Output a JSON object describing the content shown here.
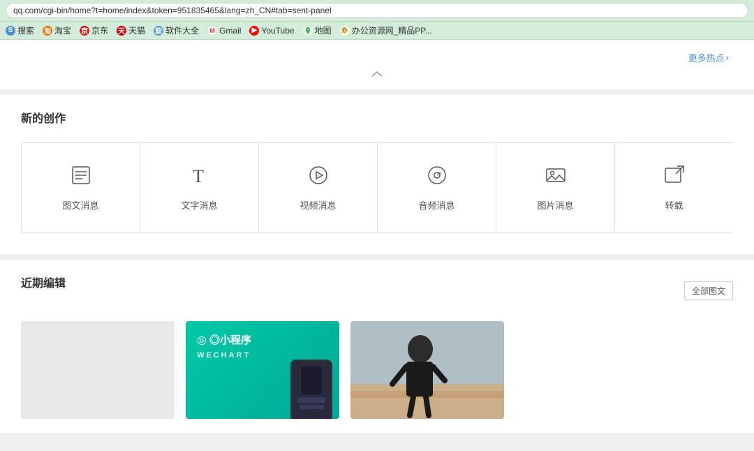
{
  "browser": {
    "url": "qq.com/cgi-bin/home?t=home/index&token=951835465&lang=zh_CN#tab=sent-panel",
    "bookmarks": [
      {
        "id": "search",
        "label": "搜索",
        "icon_color": "#4a90d9",
        "icon_char": "S"
      },
      {
        "id": "taobao",
        "label": "淘宝",
        "icon_color": "#ff6a00",
        "icon_char": "淘"
      },
      {
        "id": "jd",
        "label": "京东",
        "icon_color": "#e31818",
        "icon_char": "京"
      },
      {
        "id": "tmall",
        "label": "天猫",
        "icon_color": "#cc0000",
        "icon_char": "天"
      },
      {
        "id": "soft",
        "label": "软件大全",
        "icon_color": "#5b9bd5",
        "icon_char": "软"
      },
      {
        "id": "gmail",
        "label": "Gmail",
        "icon_color": "#ea4335",
        "icon_char": "M"
      },
      {
        "id": "youtube",
        "label": "YouTube",
        "icon_color": "#ff0000",
        "icon_char": "▶"
      },
      {
        "id": "map",
        "label": "地图",
        "icon_color": "#34a853",
        "icon_char": "图"
      },
      {
        "id": "office",
        "label": "办公资源网_精品PP...",
        "icon_color": "#f4b400",
        "icon_char": "办"
      }
    ]
  },
  "hotspot": {
    "more_label": "更多热点",
    "chevron_char": "›"
  },
  "creation": {
    "section_title": "新的创作",
    "items": [
      {
        "id": "graphic-msg",
        "label": "图文消息",
        "icon": "graphic"
      },
      {
        "id": "text-msg",
        "label": "文字消息",
        "icon": "text"
      },
      {
        "id": "video-msg",
        "label": "视频消息",
        "icon": "video"
      },
      {
        "id": "audio-msg",
        "label": "音频消息",
        "icon": "audio"
      },
      {
        "id": "image-msg",
        "label": "图片消息",
        "icon": "image"
      },
      {
        "id": "repost-msg",
        "label": "转载",
        "icon": "repost"
      }
    ]
  },
  "recent": {
    "section_title": "近期编辑",
    "view_all_label": "全部图文",
    "items": [
      {
        "id": "blank",
        "type": "blank"
      },
      {
        "id": "mini-program",
        "type": "teal",
        "title": "◎小程序",
        "subtitle": "WECHART"
      },
      {
        "id": "person-photo",
        "type": "photo"
      }
    ]
  }
}
